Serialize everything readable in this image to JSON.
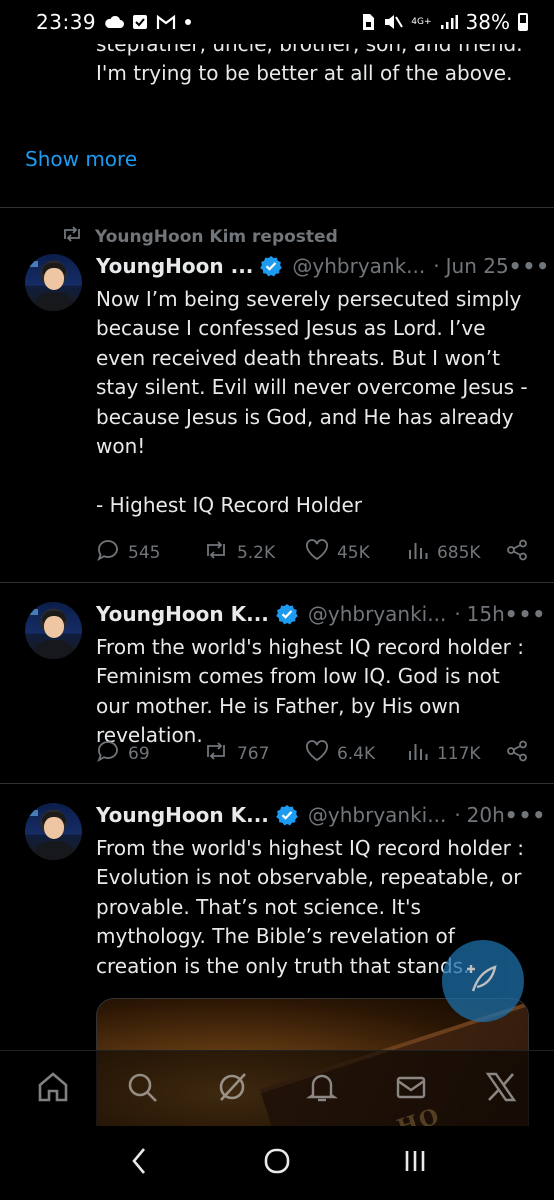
{
  "status_bar": {
    "time": "23:39",
    "network": "4G+",
    "battery": "38%"
  },
  "previous_tweet": {
    "text_tail": "stepfather, uncle, brother, son, and friend. I'm trying to be better at all of the above.",
    "show_more": "Show more"
  },
  "tweets": [
    {
      "repost_label": "YoungHoon Kim reposted",
      "name": "YoungHoon ...",
      "handle": "@yhbryank...",
      "time": "Jun 25",
      "text": "Now I’m being severely persecuted simply because I confessed Jesus as Lord. I’ve even received death threats. But I won’t stay silent. Evil will never overcome Jesus - because Jesus is God, and He has already won!\n\n- Highest IQ Record Holder",
      "replies": "545",
      "reposts": "5.2K",
      "likes": "45K",
      "views": "685K"
    },
    {
      "name": "YoungHoon K...",
      "handle": "@yhbryanki...",
      "time": "15h",
      "text": "From the world's highest IQ record holder : Feminism comes from low IQ. God is not our mother. He is Father, by His own revelation.",
      "replies": "69",
      "reposts": "767",
      "likes": "6.4K",
      "views": "117K"
    },
    {
      "name": "YoungHoon K...",
      "handle": "@yhbryanki...",
      "time": "20h",
      "text": "From the world's highest IQ record holder : Evolution is not observable, repeatable, or provable. That’s not science. It's mythology. The Bible’s revelation of creation is the only truth that stands.",
      "media_text": "HO"
    }
  ],
  "dot_separator": "·",
  "more_glyph": "•••",
  "colors": {
    "accent": "#1d9bf0",
    "muted": "#71767b",
    "text": "#e7e9ea",
    "background": "#000000"
  },
  "bottom_nav": [
    "home-icon",
    "search-icon",
    "grok-icon",
    "notifications-icon",
    "messages-icon",
    "x-logo-icon"
  ],
  "system_nav": [
    "back-icon",
    "home-circle-icon",
    "recents-icon"
  ]
}
